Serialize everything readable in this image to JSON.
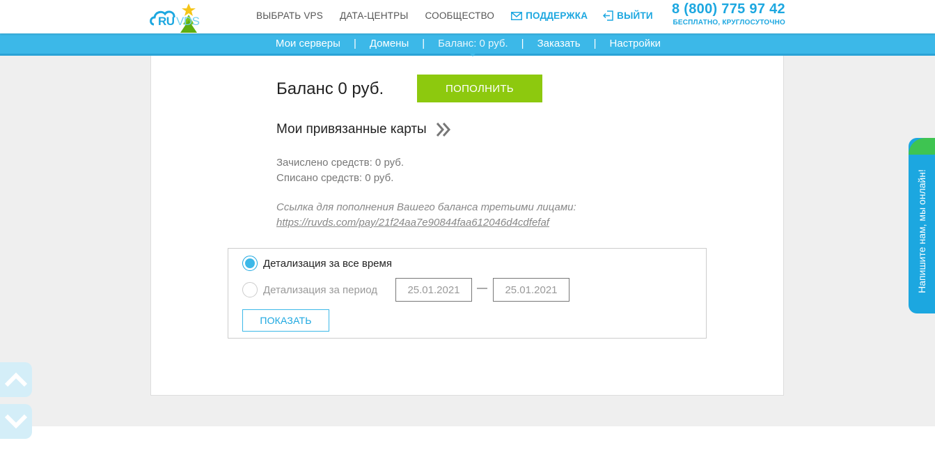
{
  "header": {
    "logo": {
      "ru": "RU",
      "vds": "VDS"
    },
    "nav": [
      {
        "label": "ВЫБРАТЬ VPS"
      },
      {
        "label": "ДАТА-ЦЕНТРЫ"
      },
      {
        "label": "СООБЩЕСТВО"
      }
    ],
    "support_label": "ПОДДЕРЖКА",
    "logout_label": "ВЫЙТИ",
    "phone": "8 (800) 775 97 42",
    "phone_note": "БЕСПЛАТНО, КРУГЛОСУТОЧНО"
  },
  "subnav": {
    "servers": "Мои серверы",
    "domains": "Домены",
    "balance": "Баланс: 0 руб.",
    "order": "Заказать",
    "settings": "Настройки"
  },
  "balance": {
    "title": "Баланс 0 руб.",
    "topup_label": "ПОПОЛНИТЬ",
    "cards_link": "Мои привязанные карты",
    "credited": "Зачислено средств: 0 руб.",
    "debited": "Списано средств: 0 руб.",
    "pay_label": "Ссылка для пополнения Вашего баланса третьими лицами:",
    "pay_link": "https://ruvds.com/pay/21f24aa7e90844faa612046d4cdfefaf"
  },
  "details": {
    "all_time_label": "Детализация за все время",
    "period_label": "Детализация за период",
    "date_from": "25.01.2021",
    "date_separator": "—",
    "date_to": "25.01.2021",
    "show_label": "ПОКАЗАТЬ",
    "selected": "all_time"
  },
  "chat": {
    "label": "Напишите нам, мы онлайн!"
  },
  "colors": {
    "accent": "#1ca7e0",
    "subnav": "#3cb8e8",
    "topup": "#8dc90e",
    "online": "#3ec451"
  }
}
